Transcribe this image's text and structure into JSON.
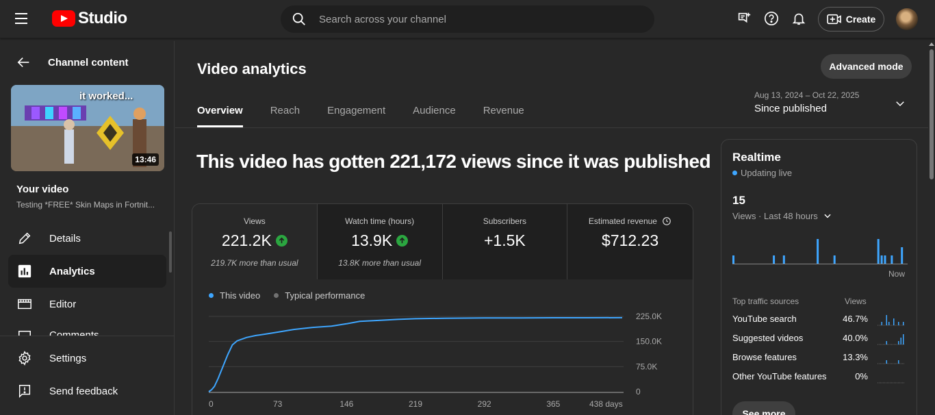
{
  "app": {
    "logo_text": "Studio"
  },
  "search": {
    "placeholder": "Search across your channel"
  },
  "topbar": {
    "create_label": "Create"
  },
  "sidebar": {
    "back_label": "Channel content",
    "thumbnail": {
      "caption": "it worked...",
      "duration": "13:46"
    },
    "your_video_label": "Your video",
    "video_title": "Testing *FREE* Skin Maps in Fortnit...",
    "items": [
      {
        "label": "Details",
        "icon": "pencil-icon"
      },
      {
        "label": "Analytics",
        "icon": "analytics-icon"
      },
      {
        "label": "Editor",
        "icon": "film-icon"
      },
      {
        "label": "Comments",
        "icon": "comment-icon"
      }
    ],
    "bottom_items": [
      {
        "label": "Settings",
        "icon": "gear-icon"
      },
      {
        "label": "Send feedback",
        "icon": "feedback-icon"
      }
    ]
  },
  "main": {
    "title": "Video analytics",
    "advanced_mode_label": "Advanced mode",
    "tabs": [
      {
        "label": "Overview"
      },
      {
        "label": "Reach"
      },
      {
        "label": "Engagement"
      },
      {
        "label": "Audience"
      },
      {
        "label": "Revenue"
      }
    ],
    "date_range": "Aug 13, 2024 – Oct 22, 2025",
    "date_label": "Since published",
    "headline": "This video has gotten 221,172 views since it was published",
    "metrics": [
      {
        "label": "Views",
        "value": "221.2K",
        "sub": "219.7K more than usual",
        "trend": "up"
      },
      {
        "label": "Watch time (hours)",
        "value": "13.9K",
        "sub": "13.8K more than usual",
        "trend": "up"
      },
      {
        "label": "Subscribers",
        "value": "+1.5K",
        "sub": "",
        "trend": ""
      },
      {
        "label": "Estimated revenue",
        "value": "$712.23",
        "sub": "",
        "trend": ""
      }
    ],
    "legend": {
      "this_video": "This video",
      "typical": "Typical performance"
    },
    "colors": {
      "accent": "#3ea6ff",
      "typical": "#717171",
      "positive": "#2ba640"
    }
  },
  "chart_data": {
    "type": "line",
    "series": [
      {
        "name": "This video",
        "x": [
          0,
          3,
          6,
          10,
          15,
          20,
          25,
          30,
          40,
          50,
          60,
          73,
          90,
          110,
          130,
          146,
          160,
          180,
          200,
          219,
          250,
          292,
          330,
          365,
          400,
          438
        ],
        "y": [
          0,
          6000,
          16000,
          40000,
          75000,
          110000,
          140000,
          152000,
          162000,
          168000,
          172000,
          178000,
          186000,
          192000,
          196000,
          203000,
          210000,
          213000,
          216000,
          218000,
          219500,
          220200,
          220600,
          220900,
          221000,
          221172
        ]
      }
    ],
    "x_ticks": [
      "0",
      "73",
      "146",
      "219",
      "292",
      "365",
      "438 days"
    ],
    "y_ticks": [
      "0",
      "75.0K",
      "150.0K",
      "225.0K"
    ],
    "xlim": [
      0,
      438
    ],
    "ylim": [
      0,
      225000
    ],
    "grid": true,
    "legend_position": "top-left"
  },
  "realtime": {
    "title": "Realtime",
    "status": "Updating live",
    "count": "15",
    "period": "Views · Last 48 hours",
    "now_label": "Now",
    "bars": [
      1,
      0,
      0,
      0,
      0,
      0,
      0,
      0,
      0,
      0,
      0,
      0,
      1,
      0,
      0,
      1,
      0,
      0,
      0,
      0,
      0,
      0,
      0,
      0,
      0,
      3,
      0,
      0,
      0,
      0,
      1,
      0,
      0,
      0,
      0,
      0,
      0,
      0,
      0,
      0,
      0,
      0,
      0,
      3,
      1,
      1,
      0,
      1,
      0,
      0,
      2,
      0
    ],
    "traffic_header": "Top traffic sources",
    "views_header": "Views",
    "sources": [
      {
        "name": "YouTube search",
        "pct": "46.7%",
        "spark": [
          0,
          1,
          0,
          3,
          1,
          0,
          2,
          0,
          1,
          0,
          1
        ]
      },
      {
        "name": "Suggested videos",
        "pct": "40.0%",
        "spark": [
          0,
          0,
          0,
          1,
          0,
          0,
          0,
          0,
          1,
          2,
          3
        ]
      },
      {
        "name": "Browse features",
        "pct": "13.3%",
        "spark": [
          0,
          0,
          0,
          1,
          0,
          0,
          0,
          0,
          1,
          0,
          0
        ]
      },
      {
        "name": "Other YouTube features",
        "pct": "0%",
        "spark": [
          0,
          0,
          0,
          0,
          0,
          0,
          0,
          0,
          0,
          0,
          0
        ]
      }
    ],
    "see_more": "See more"
  }
}
